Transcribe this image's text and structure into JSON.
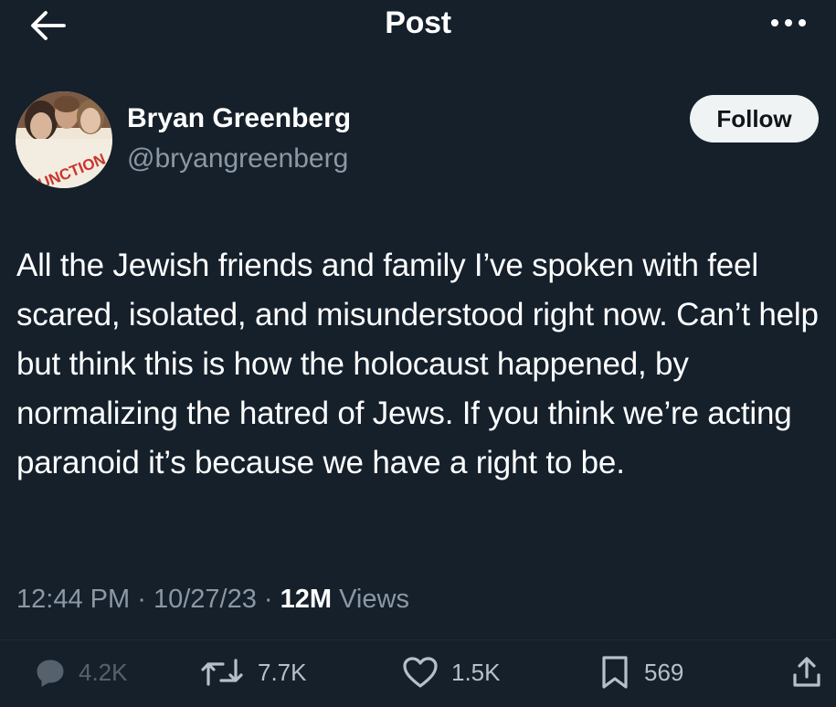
{
  "header": {
    "title": "Post",
    "back_icon": "arrow-left-icon",
    "more_icon": "ellipsis-icon"
  },
  "author": {
    "name": "Bryan Greenberg",
    "handle": "@bryangreenberg",
    "avatar_text": "JUNCTION",
    "follow_label": "Follow"
  },
  "post": {
    "text": "All the Jewish friends and family I’ve spoken with feel scared, isolated, and misunderstood right now. Can’t help but think this is how the holocaust happened, by normalizing the hatred of Jews. If you think we’re acting paranoid it’s because we have a right to be.",
    "time": "12:44 PM",
    "separator": "·",
    "date": "10/27/23",
    "views_count": "12M",
    "views_label": "Views"
  },
  "actions": {
    "replies": "4.2K",
    "reposts": "7.7K",
    "likes": "1.5K",
    "bookmarks": "569"
  },
  "colors": {
    "background": "#15202b",
    "text": "#ffffff",
    "secondary": "#8b98a5",
    "follow_bg": "#eff3f4",
    "follow_text": "#0f1419"
  }
}
